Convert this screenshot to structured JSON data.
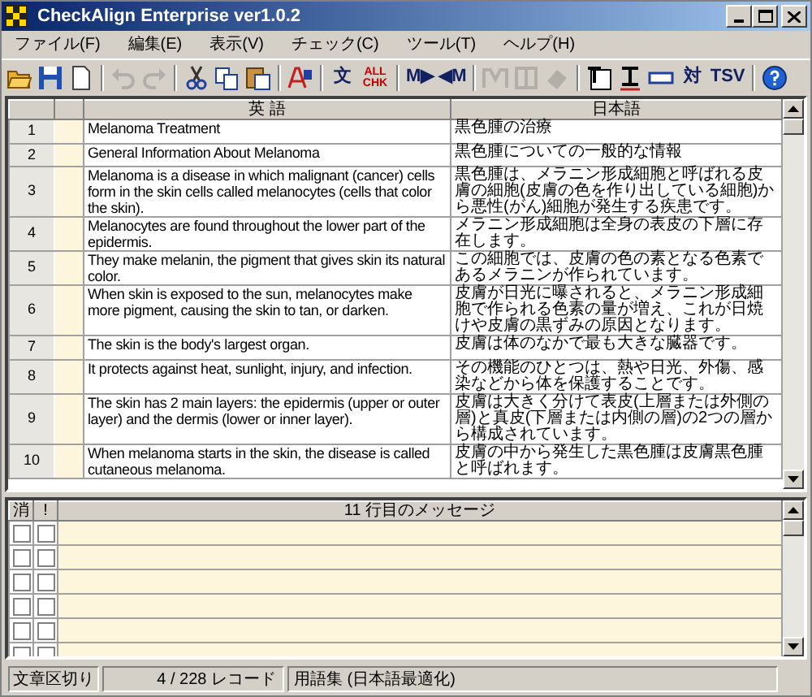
{
  "window": {
    "title": "CheckAlign Enterprise ver1.0.2"
  },
  "menu": [
    "ファイル(F)",
    "編集(E)",
    "表示(V)",
    "チェック(C)",
    "ツール(T)",
    "ヘルプ(H)"
  ],
  "toolbar": [
    {
      "kind": "icon",
      "disabled": false
    },
    {
      "kind": "icon",
      "disabled": false
    },
    {
      "kind": "icon",
      "disabled": false
    },
    {
      "kind": "separator"
    },
    {
      "kind": "icon",
      "disabled": true
    },
    {
      "kind": "icon",
      "disabled": true
    },
    {
      "kind": "separator"
    },
    {
      "kind": "icon",
      "disabled": false
    },
    {
      "kind": "icon",
      "disabled": false
    },
    {
      "kind": "icon",
      "disabled": false
    },
    {
      "kind": "separator"
    },
    {
      "kind": "icon",
      "disabled": false
    },
    {
      "kind": "separator"
    },
    {
      "kind": "text",
      "label": "文",
      "disabled": false
    },
    {
      "kind": "text",
      "label": "ALL CHK",
      "disabled": false
    },
    {
      "kind": "separator"
    },
    {
      "kind": "text",
      "label": "M▶",
      "disabled": false
    },
    {
      "kind": "text",
      "label": "◀M",
      "disabled": false
    },
    {
      "kind": "separator"
    },
    {
      "kind": "icon",
      "disabled": true
    },
    {
      "kind": "icon",
      "disabled": true
    },
    {
      "kind": "icon",
      "disabled": true
    },
    {
      "kind": "separator"
    },
    {
      "kind": "icon",
      "disabled": false
    },
    {
      "kind": "icon",
      "disabled": false
    },
    {
      "kind": "icon",
      "disabled": false
    },
    {
      "kind": "text",
      "label": "対",
      "disabled": false
    },
    {
      "kind": "text",
      "label": "TSV",
      "disabled": false
    },
    {
      "kind": "separator"
    },
    {
      "kind": "icon",
      "disabled": false
    }
  ],
  "grid": {
    "columns": [
      "英 語",
      "日本語"
    ],
    "rows": [
      {
        "number": "1",
        "english": "Melanoma Treatment",
        "japanese": "黒色腫の治療"
      },
      {
        "number": "2",
        "english": "General Information About Melanoma",
        "japanese": "黒色腫についての一般的な情報"
      },
      {
        "number": "3",
        "english": "Melanoma is a disease in which malignant (cancer) cells form in the skin cells called melanocytes (cells that color the skin).",
        "japanese": "黒色腫は、メラニン形成細胞と呼ばれる皮膚の細胞(皮膚の色を作り出している細胞)から悪性(がん)細胞が発生する疾患です。"
      },
      {
        "number": "4",
        "english": "Melanocytes are found throughout the lower part of the epidermis.",
        "japanese": "メラニン形成細胞は全身の表皮の下層に存在します。"
      },
      {
        "number": "5",
        "english": "They make melanin, the pigment that gives skin its natural color.",
        "japanese": "この細胞では、皮膚の色の素となる色素であるメラニンが作られています。"
      },
      {
        "number": "6",
        "english": "When skin is exposed to the sun, melanocytes make more pigment, causing the skin to tan, or darken.",
        "japanese": "皮膚が日光に曝されると、メラニン形成細胞で作られる色素の量が増え、これが日焼けや皮膚の黒ずみの原因となります。"
      },
      {
        "number": "7",
        "english": "The skin is the body's largest organ.",
        "japanese": "皮膚は体のなかで最も大きな臓器です。"
      },
      {
        "number": "8",
        "english": "It protects against heat, sunlight, injury, and infection.",
        "japanese": "その機能のひとつは、熱や日光、外傷、感染などから体を保護することです。"
      },
      {
        "number": "9",
        "english": "The skin has 2 main layers: the epidermis (upper or outer layer) and the dermis (lower or inner layer).",
        "japanese": "皮膚は大きく分けて表皮(上層または外側の層)と真皮(下層または内側の層)の2つの層から構成されています。"
      },
      {
        "number": "10",
        "english": "When melanoma starts in the skin, the disease is called cutaneous melanoma.",
        "japanese": "皮膚の中から発生した黒色腫は皮膚黒色腫と呼ばれます。"
      }
    ]
  },
  "messages": {
    "columns": [
      "消",
      "!",
      "11 行目のメッセージ"
    ],
    "rows": [
      {
        "checks": [
          {
            "checked": false
          },
          {
            "checked": false
          }
        ]
      },
      {
        "checks": [
          {
            "checked": false
          },
          {
            "checked": false
          }
        ]
      },
      {
        "checks": [
          {
            "checked": false
          },
          {
            "checked": false
          }
        ]
      },
      {
        "checks": [
          {
            "checked": false
          },
          {
            "checked": false
          }
        ]
      },
      {
        "checks": [
          {
            "checked": false
          },
          {
            "checked": false
          }
        ]
      },
      {
        "checks": [
          {
            "checked": false
          },
          {
            "checked": false
          }
        ]
      }
    ]
  },
  "status_bar": [
    "文章区切り",
    "4 / 228 レコード",
    "用語集 (日本語最適化)"
  ]
}
